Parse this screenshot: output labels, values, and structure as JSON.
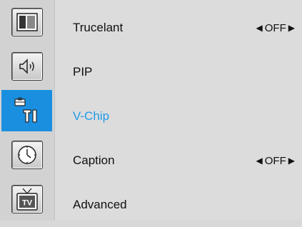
{
  "sidebar": {
    "items": [
      {
        "icon": "picture-icon",
        "active": false
      },
      {
        "icon": "sound-icon",
        "active": false
      },
      {
        "icon": "setup-icon",
        "active": true
      },
      {
        "icon": "clock-icon",
        "active": false
      },
      {
        "icon": "tv-icon",
        "active": false,
        "text": "TV"
      }
    ]
  },
  "menu": {
    "items": [
      {
        "label": "Trucelant",
        "value": "OFF"
      },
      {
        "label": "PIP",
        "value": ""
      },
      {
        "label": "V-Chip",
        "value": ""
      },
      {
        "label": "Caption",
        "value": "OFF"
      },
      {
        "label": "Advanced",
        "value": ""
      }
    ],
    "arrows": {
      "left": "◀",
      "right": "▶"
    }
  },
  "colors": {
    "active": "#1a8fe0",
    "active_text": "#1e9be8",
    "background": "#dcdcdc"
  }
}
